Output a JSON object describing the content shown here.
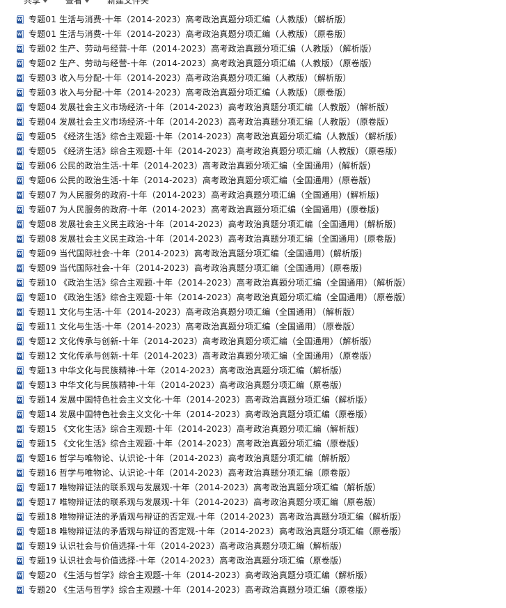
{
  "toolbar": {
    "items": [
      "共享",
      "查看",
      "新建文件夹"
    ]
  },
  "icon": {
    "name": "word-document-icon",
    "color": "#2b579a",
    "badge_letter": "W"
  },
  "files": [
    "专题01 生活与消费-十年（2014-2023）高考政治真题分项汇编（人教版）（解析版）",
    "专题01 生活与消费-十年（2014-2023）高考政治真题分项汇编（人教版）（原卷版）",
    "专题02  生产、劳动与经营-十年（2014-2023）高考政治真题分项汇编（人教版）（解析版）",
    "专题02  生产、劳动与经营-十年（2014-2023）高考政治真题分项汇编（人教版）（原卷版）",
    "专题03 收入与分配-十年（2014-2023）高考政治真题分项汇编（人教版）（解析版）",
    "专题03 收入与分配-十年（2014-2023）高考政治真题分项汇编（人教版）（原卷版）",
    "专题04 发展社会主义市场经济-十年（2014-2023）高考政治真题分项汇编（人教版）（解析版）",
    "专题04 发展社会主义市场经济-十年（2014-2023）高考政治真题分项汇编（人教版）（原卷版）",
    "专题05 《经济生活》综合主观题-十年（2014-2023）高考政治真题分项汇编（人教版）（解析版）",
    "专题05 《经济生活》综合主观题-十年（2014-2023）高考政治真题分项汇编（人教版）（原卷版）",
    "专题06 公民的政治生活-十年（2014-2023）高考政治真题分项汇编（全国通用）(解析版)",
    "专题06 公民的政治生活-十年（2014-2023）高考政治真题分项汇编（全国通用）(原卷版)",
    "专题07 为人民服务的政府-十年（2014-2023）高考政治真题分项汇编（全国通用）(解析版)",
    "专题07 为人民服务的政府-十年（2014-2023）高考政治真题分项汇编（全国通用）(原卷版)",
    "专题08 发展社会主义民主政治-十年（2014-2023）高考政治真题分项汇编（全国通用）(解析版)",
    "专题08 发展社会主义民主政治-十年（2014-2023）高考政治真题分项汇编（全国通用）(原卷版)",
    "专题09 当代国际社会-十年（2014-2023）高考政治真题分项汇编（全国通用）(解析版)",
    "专题09 当代国际社会-十年（2014-2023）高考政治真题分项汇编（全国通用）(原卷版)",
    "专题10 《政治生活》综合主观题-十年（2014-2023）高考政治真题分项汇编（全国通用）（解析版）",
    "专题10 《政治生活》综合主观题-十年（2014-2023）高考政治真题分项汇编（全国通用）（原卷版）",
    "专题11 文化与生活-十年（2014-2023）高考政治真题分项汇编（全国通用）（解析版）",
    "专题11 文化与生活-十年（2014-2023）高考政治真题分项汇编（全国通用）（原卷版）",
    "专题12 文化传承与创新-十年（2014-2023）高考政治真题分项汇编（全国通用）（解析版）",
    "专题12 文化传承与创新-十年（2014-2023）高考政治真题分项汇编（全国通用）（原卷版）",
    "专题13 中华文化与民族精神-十年（2014-2023）高考政治真题分项汇编（解析版）",
    "专题13 中华文化与民族精神-十年（2014-2023）高考政治真题分项汇编（原卷版）",
    "专题14 发展中国特色社会主义文化-十年（2014-2023）高考政治真题分项汇编（解析版）",
    "专题14 发展中国特色社会主义文化-十年（2014-2023）高考政治真题分项汇编（原卷版）",
    "专题15 《文化生活》综合主观题-十年（2014-2023）高考政治真题分项汇编（解析版）",
    "专题15 《文化生活》综合主观题-十年（2014-2023）高考政治真题分项汇编（原卷版）",
    "专题16 哲学与唯物论、认识论-十年（2014-2023）高考政治真题分项汇编（解析版）",
    "专题16 哲学与唯物论、认识论-十年（2014-2023）高考政治真题分项汇编（原卷版）",
    "专题17 唯物辩证法的联系观与发展观-十年（2014-2023）高考政治真题分项汇编（解析版）",
    "专题17 唯物辩证法的联系观与发展观-十年（2014-2023）高考政治真题分项汇编（原卷版）",
    "专题18 唯物辩证法的矛盾观与辩证的否定观-十年（2014-2023）高考政治真题分项汇编（解析版）",
    "专题18 唯物辩证法的矛盾观与辩证的否定观-十年（2014-2023）高考政治真题分项汇编（原卷版）",
    "专题19 认识社会与价值选择-十年（2014-2023）高考政治真题分项汇编（解析版）",
    "专题19 认识社会与价值选择-十年（2014-2023）高考政治真题分项汇编（原卷版）",
    "专题20 《生活与哲学》综合主观题-十年（2014-2023）高考政治真题分项汇编（解析版）",
    "专题20 《生活与哲学》综合主观题-十年（2014-2023）高考政治真题分项汇编（原卷版）"
  ]
}
